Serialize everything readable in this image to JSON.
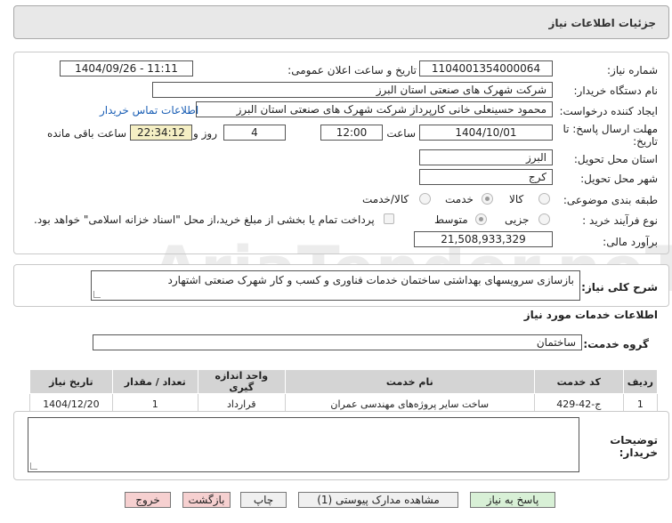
{
  "header": {
    "title": "جزئیات اطلاعات نیاز"
  },
  "fields": {
    "need_number_label": "شماره نیاز:",
    "need_number": "1104001354000064",
    "announce_label": "تاریخ و ساعت اعلان عمومی:",
    "announce_value": "1404/09/26 - 11:11",
    "buyer_org_label": "نام دستگاه خریدار:",
    "buyer_org": "شرکت شهرک های صنعتی استان البرز",
    "creator_label": "ایجاد کننده درخواست:",
    "creator": "محمود حسینعلی خانی کارپرداز شرکت شهرک های صنعتی استان البرز",
    "contact_link": "اطلاعات تماس خریدار",
    "deadline_label": "مهلت ارسال پاسخ: تا تاریخ:",
    "deadline_date": "1404/10/01",
    "time_label": "ساعت",
    "deadline_time": "12:00",
    "days_value": "4",
    "days_label": "روز و",
    "remaining_time": "22:34:12",
    "remaining_label": "ساعت باقی مانده",
    "province_label": "استان محل تحویل:",
    "province": "البرز",
    "city_label": "شهر محل تحویل:",
    "city": "کرج",
    "category_label": "طبقه بندی موضوعی:",
    "category_options": [
      "کالا",
      "خدمت",
      "کالا/خدمت"
    ],
    "process_label": "نوع فرآیند خرید :",
    "process_options": [
      "جزیی",
      "متوسط"
    ],
    "payment_note": "پرداخت تمام یا بخشی از مبلغ خرید،از محل \"اسناد خزانه اسلامی\" خواهد بود.",
    "budget_label": "برآورد مالی:",
    "budget": "21,508,933,329"
  },
  "summary": {
    "label": "شرح کلی نیاز:",
    "text": "بازسازی سرویسهای بهداشتی ساختمان خدمات فناوری و کسب و کار شهرک صنعتی اشتهارد"
  },
  "services": {
    "section_title": "اطلاعات خدمات مورد نیاز",
    "group_label": "گروه خدمت:",
    "group_value": "ساختمان",
    "columns": [
      "ردیف",
      "کد خدمت",
      "نام خدمت",
      "واحد اندازه گیری",
      "تعداد / مقدار",
      "تاریخ نیاز"
    ],
    "rows": [
      [
        "1",
        "ج-42-429",
        "ساخت سایر پروژه‌های مهندسی عمران",
        "قرارداد",
        "1",
        "1404/12/20"
      ]
    ]
  },
  "notes": {
    "label": "توضیحات خریدار:",
    "value": ""
  },
  "buttons": {
    "reply": "پاسخ به نیاز",
    "attachments": "مشاهده مدارک پیوستی (1)",
    "print": "چاپ",
    "back": "بازگشت",
    "exit": "خروج"
  },
  "watermark": "AriaTender.neT",
  "colors": {
    "link": "#1b5fb5",
    "remaining_bg": "#f5efc4",
    "exit_bg": "#f6d0d0",
    "reply_bg": "#d8f0d6"
  }
}
